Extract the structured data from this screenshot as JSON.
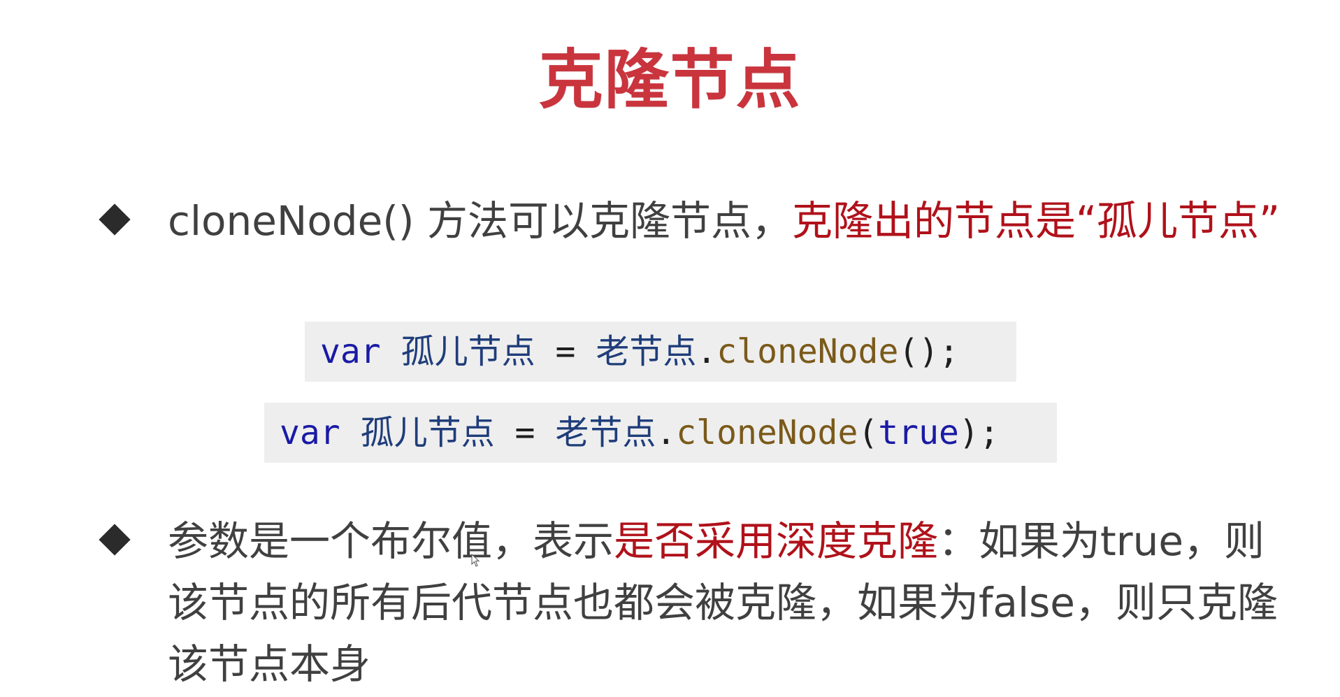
{
  "slide": {
    "title": "克隆节点",
    "bullet1": {
      "text_plain": "cloneNode() 方法可以克隆节点，",
      "text_red": "克隆出的节点是“孤儿节点”"
    },
    "code1": {
      "kw": "var",
      "var_name": "孤儿节点",
      "eq": "=",
      "obj": "老节点",
      "dot": ".",
      "method": "cloneNode",
      "args_open": "(",
      "args": "",
      "args_close": ");"
    },
    "code2": {
      "kw": "var",
      "var_name": "孤儿节点",
      "eq": "=",
      "obj": "老节点",
      "dot": ".",
      "method": "cloneNode",
      "args_open": "(",
      "args": "true",
      "args_close": ");"
    },
    "bullet2": {
      "text_plain_1": "参数是一个布尔值，表示",
      "text_red": "是否采用深度克隆",
      "text_plain_2": "：如果为true，则该节点的所有后代节点也都会被克隆，如果为false，则只克隆该节点本身"
    }
  },
  "colors": {
    "title": "#c9343d",
    "emphasis_red": "#b0111a",
    "code_bg": "#eeeeee",
    "keyword_blue": "#1a1aa6",
    "method_brown": "#7a5a1a"
  }
}
